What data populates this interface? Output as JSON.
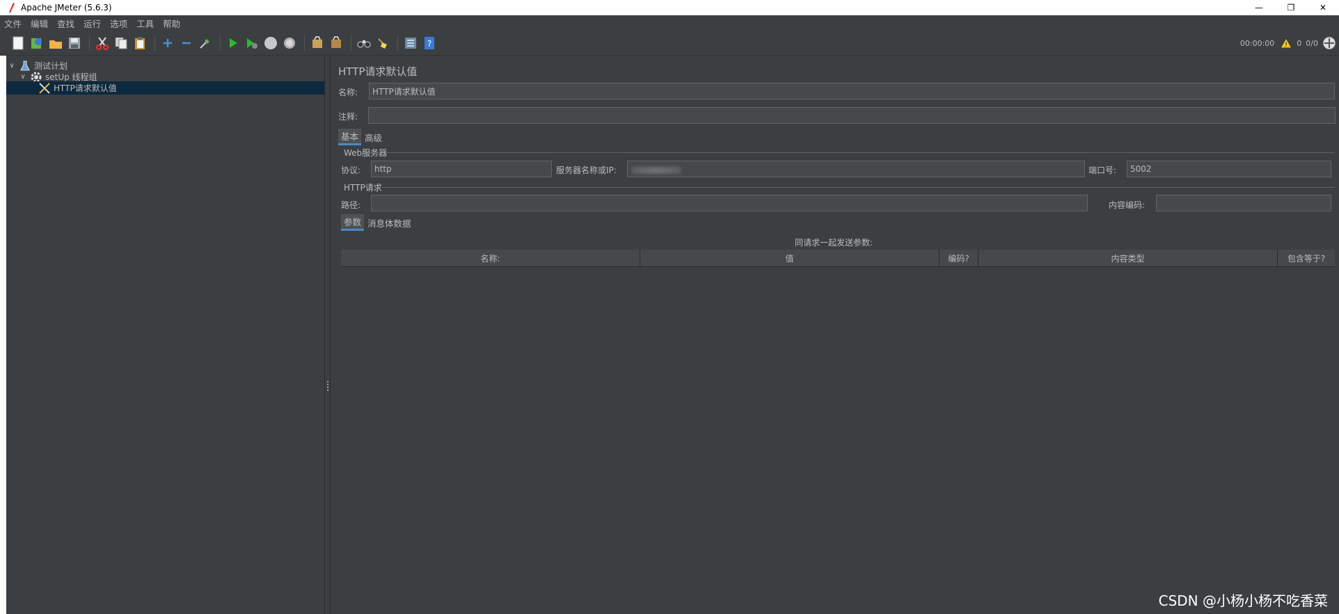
{
  "window": {
    "title": "Apache JMeter (5.6.3)",
    "controls": [
      "—",
      "❐",
      "✕"
    ]
  },
  "menubar": [
    "文件",
    "编辑",
    "查找",
    "运行",
    "选项",
    "工具",
    "帮助"
  ],
  "toolbar": {
    "timer": "00:00:00",
    "warning_count": "0",
    "threads": "0/0"
  },
  "tree": {
    "items": [
      {
        "label": "测试计划",
        "toggle": "∨"
      },
      {
        "label": "setUp 线程组",
        "toggle": "∨"
      },
      {
        "label": "HTTP请求默认值",
        "toggle": ""
      }
    ]
  },
  "panel": {
    "title": "HTTP请求默认值",
    "name_label": "名称:",
    "name_value": "HTTP请求默认值",
    "comment_label": "注释:",
    "comment_value": "",
    "tabs": [
      "基本",
      "高级"
    ],
    "web_server_group": "Web服务器",
    "protocol_label": "协议:",
    "protocol_value": "http",
    "server_label": "服务器名称或IP:",
    "server_value": "",
    "port_label": "端口号:",
    "port_value": "5002",
    "http_request_group": "HTTP请求",
    "path_label": "路径:",
    "path_value": "",
    "encoding_label": "内容编码:",
    "encoding_value": "",
    "sub_tabs": [
      "参数",
      "消息体数据"
    ],
    "params_caption": "同请求一起发送参数:",
    "columns": [
      "名称:",
      "值",
      "编码?",
      "内容类型",
      "包含等于?"
    ]
  },
  "watermark": "CSDN @小杨小杨不吃香菜",
  "colors": {
    "background": "#3c3f41",
    "selection": "#0d293e",
    "field": "#45494a",
    "accent": "#4a88c7"
  }
}
